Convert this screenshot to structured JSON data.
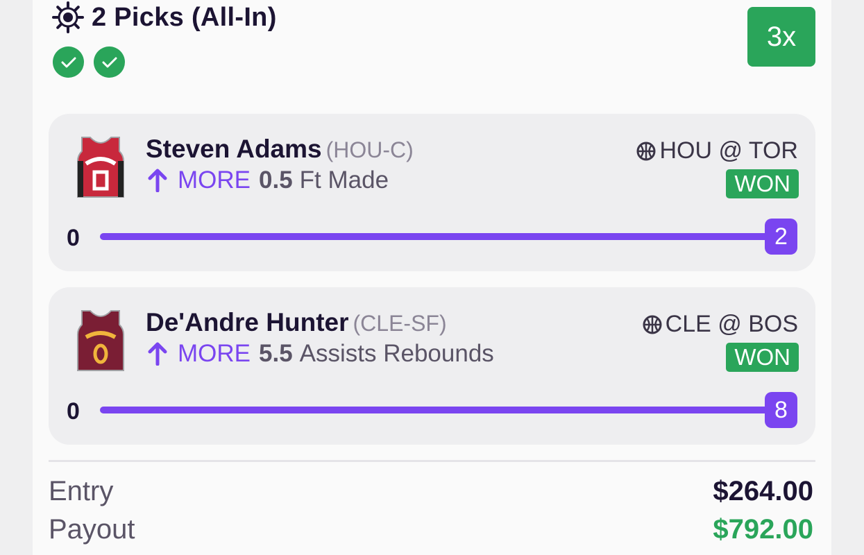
{
  "header": {
    "title": "2 Picks (All-In)",
    "multiplier": "3x"
  },
  "picks": [
    {
      "player": "Steven Adams",
      "team": "(HOU-C)",
      "direction": "MORE",
      "line": "0.5",
      "stat": "Ft Made",
      "game": "HOU @ TOR",
      "result": "WON",
      "min": "0",
      "current": "2",
      "jersey_number": "0",
      "jersey_color": "#c8283c",
      "progress": 1.0
    },
    {
      "player": "De'Andre Hunter",
      "team": "(CLE-SF)",
      "direction": "MORE",
      "line": "5.5",
      "stat": "Assists Rebounds",
      "game": "CLE @ BOS",
      "result": "WON",
      "min": "0",
      "current": "8",
      "jersey_number": "0",
      "jersey_color": "#7a1e34",
      "progress": 1.0
    }
  ],
  "summary": {
    "entry_label": "Entry",
    "entry_value": "$264.00",
    "payout_label": "Payout",
    "payout_value": "$792.00"
  },
  "colors": {
    "accent": "#7a45f0",
    "success": "#2aa55a",
    "text": "#1c1433"
  }
}
